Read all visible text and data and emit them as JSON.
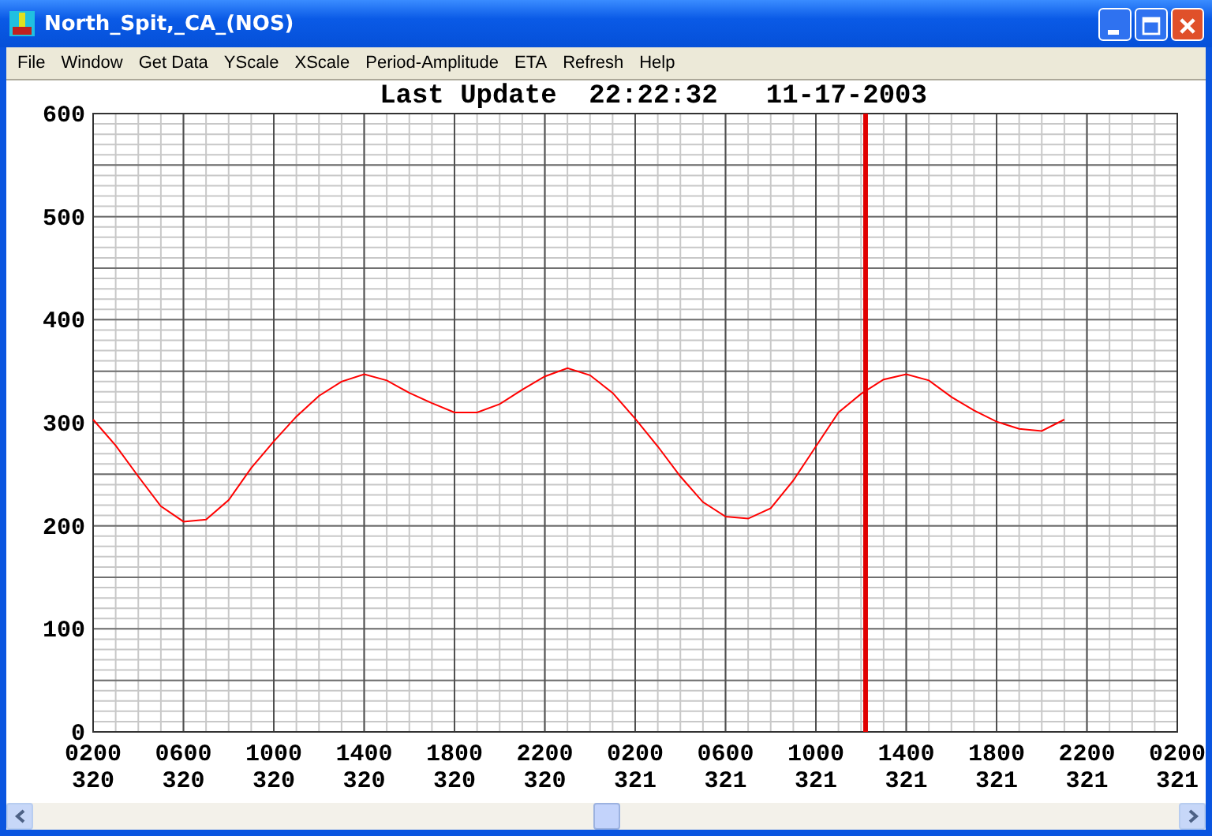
{
  "window": {
    "title": "North_Spit,_CA_(NOS)"
  },
  "menu": [
    "File",
    "Window",
    "Get Data",
    "YScale",
    "XScale",
    "Period-Amplitude",
    "ETA",
    "Refresh",
    "Help"
  ],
  "plot": {
    "chart_data": {
      "type": "line",
      "title": "Last Update  22:22:32   11-17-2003",
      "categories": [
        "0200 320",
        null,
        null,
        null,
        "0600 320",
        null,
        null,
        null,
        "1000 320",
        null,
        null,
        null,
        "1400 320",
        null,
        null,
        null,
        "1800 320",
        null,
        null,
        null,
        "2200 320",
        null,
        null,
        null,
        "0200 321",
        null,
        null,
        null,
        "0600 321",
        null,
        null,
        null,
        "1000 321",
        null,
        null,
        null,
        "1400 321",
        null,
        null,
        null,
        "1800 321",
        null,
        null,
        null,
        "2200 321",
        null,
        null,
        null,
        "0200 321"
      ],
      "series": [
        {
          "color": "#ff0000",
          "values": [
            303,
            278,
            248,
            219,
            204,
            206,
            225,
            256,
            282,
            306,
            326,
            340,
            347,
            341,
            329,
            319,
            310,
            310,
            318,
            332,
            345,
            353,
            346,
            329,
            304,
            277,
            248,
            223,
            209,
            207,
            217,
            244,
            277,
            310,
            328,
            342,
            347,
            341,
            325,
            312,
            301,
            294,
            292,
            303,
            null,
            null,
            null,
            null,
            null
          ]
        }
      ],
      "ylim": [
        0,
        600
      ],
      "yticks": [
        0,
        100,
        200,
        300,
        400,
        500,
        600
      ],
      "grid": true
    }
  }
}
